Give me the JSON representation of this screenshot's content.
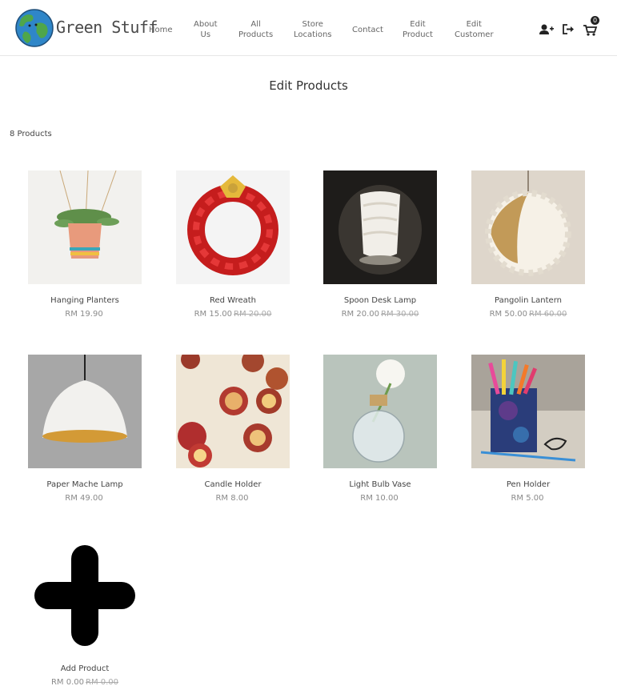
{
  "brand": {
    "name": "Green Stuff"
  },
  "nav": {
    "home": "Home",
    "about_1": "About",
    "about_2": "Us",
    "all_1": "All",
    "all_2": "Products",
    "store_1": "Store",
    "store_2": "Locations",
    "contact": "Contact",
    "editp_1": "Edit",
    "editp_2": "Product",
    "editc_1": "Edit",
    "editc_2": "Customer",
    "cart_count": "0"
  },
  "page": {
    "title": "Edit Products",
    "count": "8 Products"
  },
  "products": [
    {
      "name": "Hanging Planters",
      "price": "RM 19.90",
      "old_price": ""
    },
    {
      "name": "Red Wreath",
      "price": "RM 15.00",
      "old_price": "RM 20.00"
    },
    {
      "name": "Spoon Desk Lamp",
      "price": "RM 20.00",
      "old_price": "RM 30.00"
    },
    {
      "name": "Pangolin Lantern",
      "price": "RM 50.00",
      "old_price": "RM 60.00"
    },
    {
      "name": "Paper Mache Lamp",
      "price": "RM 49.00",
      "old_price": ""
    },
    {
      "name": "Candle Holder",
      "price": "RM 8.00",
      "old_price": ""
    },
    {
      "name": "Light Bulb Vase",
      "price": "RM 10.00",
      "old_price": ""
    },
    {
      "name": "Pen Holder",
      "price": "RM 5.00",
      "old_price": ""
    },
    {
      "name": "Add Product",
      "price": "RM 0.00",
      "old_price": "RM 0.00"
    }
  ],
  "icons": {
    "add_user": "user-plus-icon",
    "logout": "sign-out-icon",
    "cart": "shopping-cart-icon",
    "add": "plus-icon"
  },
  "colors": {
    "globe_ocean": "#2f86c8",
    "globe_land": "#4fa64a",
    "text_dark": "#333333",
    "price": "#8a8a8a"
  }
}
